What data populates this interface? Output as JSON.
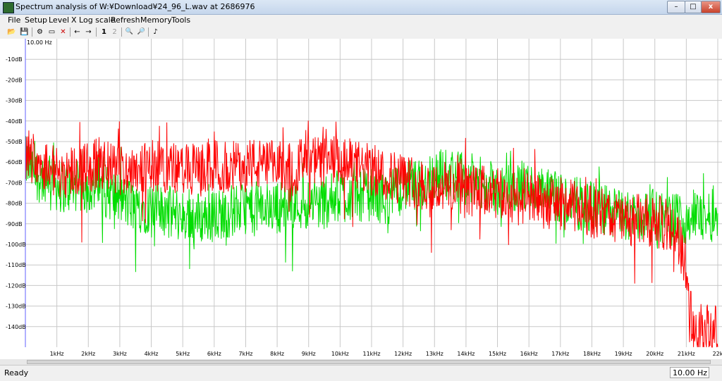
{
  "window": {
    "title": "Spectrum analysis of W:¥Download¥24_96_L.wav at 2686976",
    "minimize": "–",
    "maximize": "□",
    "close": "x"
  },
  "menu": [
    "File",
    "Setup",
    "Level",
    "X Log scale",
    "Refresh",
    "Memory",
    "Tools"
  ],
  "toolbar": {
    "open": "📂",
    "save": "💾",
    "settings": "⚙",
    "bars": "▭",
    "cursor": "✕",
    "back": "←",
    "forward": "→",
    "view1": "1",
    "view2": "2",
    "zoom_in": "🔍",
    "zoom_out": "🔎",
    "note": "♪"
  },
  "status": {
    "text": "Ready",
    "frequency": "10.00 Hz"
  },
  "colors": {
    "green": "#00dd00",
    "red": "#ff0000",
    "grid": "#c8c8c8",
    "cursor": "#6060ff"
  },
  "chart_data": {
    "type": "line",
    "cursor_label": "10.00 Hz",
    "x_ticks": [
      "1kHz",
      "2kHz",
      "3kHz",
      "4kHz",
      "5kHz",
      "6kHz",
      "7kHz",
      "8kHz",
      "9kHz",
      "10kHz",
      "11kHz",
      "12kHz",
      "13kHz",
      "14kHz",
      "15kHz",
      "16kHz",
      "17kHz",
      "18kHz",
      "19kHz",
      "20kHz",
      "21kHz",
      "22k"
    ],
    "y_ticks": [
      "-10dB",
      "-20dB",
      "-30dB",
      "-40dB",
      "-50dB",
      "-60dB",
      "-70dB",
      "-80dB",
      "-90dB",
      "-100dB",
      "-110dB",
      "-120dB",
      "-130dB",
      "-140dB"
    ],
    "xlim": [
      0,
      22000
    ],
    "ylim": [
      -150,
      0
    ],
    "grid": true,
    "series": [
      {
        "color": "#00dd00",
        "x": [
          0,
          500,
          900,
          1000,
          1500,
          2000,
          2500,
          3000,
          3500,
          4000,
          4500,
          5000,
          5500,
          6000,
          6500,
          7000,
          7500,
          8000,
          8500,
          9000,
          9500,
          10000,
          10500,
          11000,
          11500,
          12000,
          12500,
          13000,
          13500,
          14000,
          14500,
          15000,
          15500,
          16000,
          16500,
          17000,
          17500,
          18000,
          18500,
          19000,
          19500,
          20000,
          20500,
          21000,
          21500,
          22000
        ],
        "values": [
          -60,
          -68,
          -63,
          -72,
          -72,
          -72,
          -74,
          -78,
          -82,
          -82,
          -84,
          -86,
          -87,
          -86,
          -84,
          -82,
          -82,
          -82,
          -80,
          -80,
          -80,
          -76,
          -76,
          -76,
          -78,
          -72,
          -72,
          -66,
          -66,
          -68,
          -70,
          -74,
          -72,
          -72,
          -76,
          -78,
          -80,
          -82,
          -84,
          -86,
          -86,
          -86,
          -88,
          -87,
          -86,
          -86
        ]
      },
      {
        "color": "#ff0000",
        "x": [
          0,
          500,
          1000,
          1500,
          2000,
          2500,
          3000,
          3500,
          4000,
          4500,
          5000,
          5500,
          6000,
          6500,
          7000,
          7500,
          8000,
          8500,
          9000,
          9500,
          10000,
          10500,
          11000,
          11500,
          12000,
          12500,
          13000,
          13500,
          14000,
          14500,
          15000,
          15500,
          16000,
          16500,
          17000,
          17500,
          18000,
          18500,
          19000,
          19500,
          20000,
          20300,
          20600,
          20800,
          21000,
          21200,
          21500,
          22000
        ],
        "values": [
          -55,
          -60,
          -65,
          -64,
          -62,
          -62,
          -64,
          -62,
          -62,
          -62,
          -64,
          -64,
          -62,
          -63,
          -60,
          -62,
          -62,
          -62,
          -60,
          -60,
          -60,
          -62,
          -64,
          -66,
          -68,
          -70,
          -72,
          -72,
          -74,
          -74,
          -76,
          -78,
          -78,
          -80,
          -80,
          -82,
          -84,
          -86,
          -88,
          -88,
          -89,
          -90,
          -92,
          -100,
          -110,
          -140,
          -142,
          -142
        ]
      }
    ]
  }
}
